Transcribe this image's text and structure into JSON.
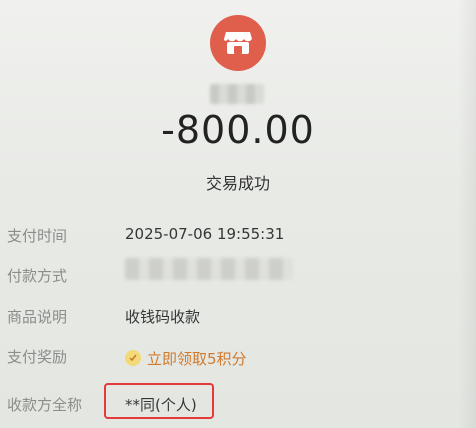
{
  "receipt": {
    "amount": "-800.00",
    "status": "交易成功"
  },
  "details": {
    "pay_time_label": "支付时间",
    "pay_time_value": "2025-07-06 19:55:31",
    "pay_method_label": "付款方式",
    "item_desc_label": "商品说明",
    "item_desc_value": "收钱码收款",
    "reward_label": "支付奖励",
    "reward_value": "立即领取5积分",
    "payee_label": "收款方全称",
    "payee_value": "**同(个人)"
  },
  "icons": {
    "store": "store-icon",
    "reward": "reward-check-icon"
  },
  "colors": {
    "store_icon_bg": "#e05e4c",
    "reward_text": "#cf7a2d",
    "highlight_box": "#e53a3a"
  }
}
